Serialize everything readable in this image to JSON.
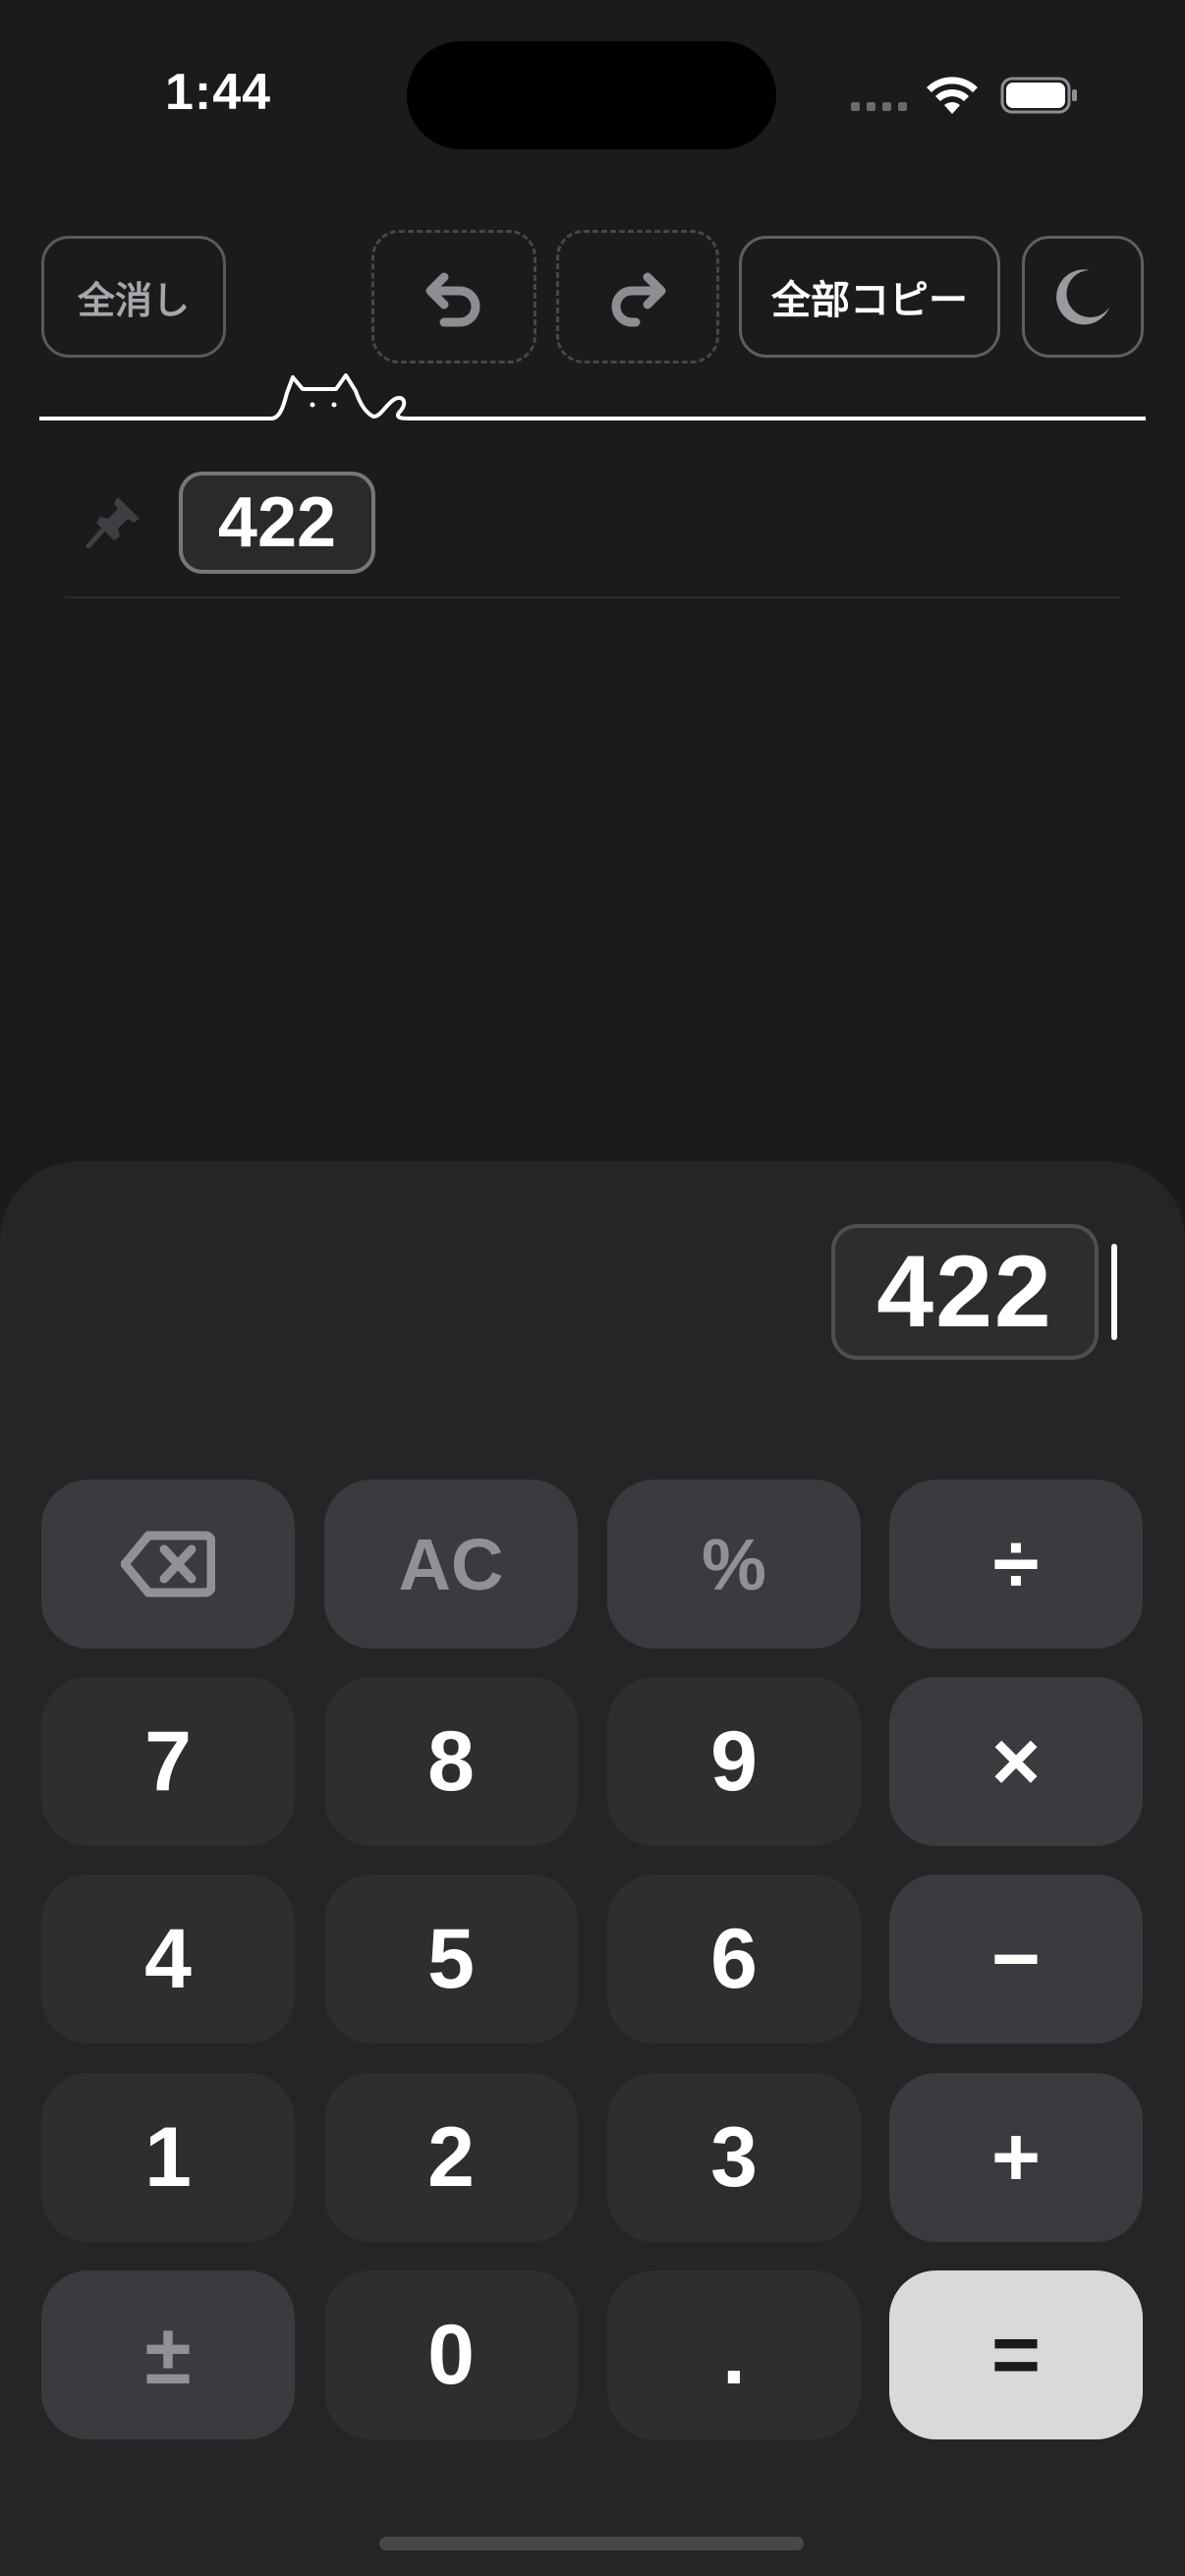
{
  "status_bar": {
    "time": "1:44",
    "icons": [
      "cellular-icon",
      "wifi-icon",
      "battery-icon"
    ]
  },
  "toolbar": {
    "clear_all_label": "全消し",
    "undo_icon": "undo-icon",
    "redo_icon": "redo-icon",
    "copy_all_label": "全部コピー",
    "theme_icon": "moon-icon"
  },
  "history": {
    "items": [
      {
        "value": "422",
        "pinned": true
      }
    ]
  },
  "display": {
    "expression": "422"
  },
  "keypad": {
    "rows": [
      [
        "⌫",
        "AC",
        "%",
        "÷"
      ],
      [
        "7",
        "8",
        "9",
        "×"
      ],
      [
        "4",
        "5",
        "6",
        "−"
      ],
      [
        "1",
        "2",
        "3",
        "+"
      ],
      [
        "±",
        "0",
        ".",
        "="
      ]
    ]
  },
  "colors": {
    "background": "#1b1b1d",
    "panel": "#252528",
    "key": "#2e2e31",
    "function_key": "#3b3b3f",
    "equals_key": "#d9d9d9"
  }
}
